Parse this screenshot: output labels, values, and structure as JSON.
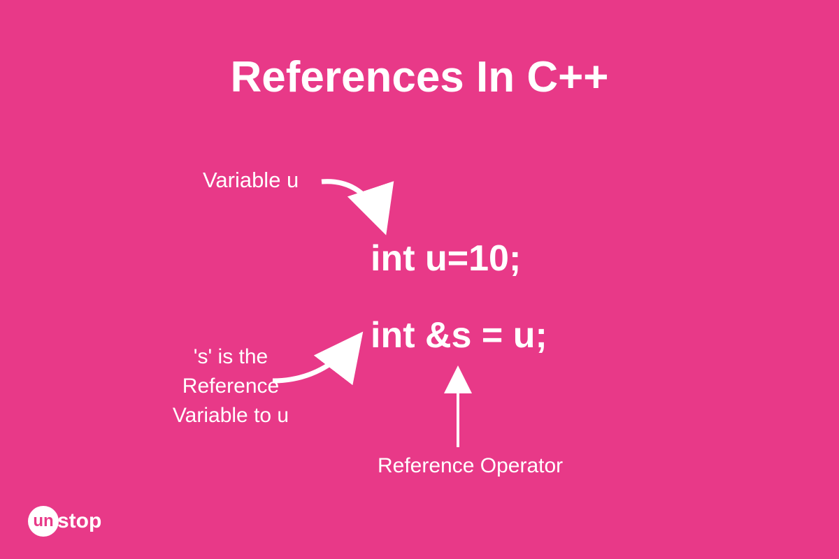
{
  "title": "References In C++",
  "labels": {
    "variable": "Variable u",
    "reference": "'s' is the Reference Variable to u",
    "operator": "Reference Operator"
  },
  "code": {
    "line1": "int u=10;",
    "line2": "int &s = u;"
  },
  "logo": {
    "circle": "un",
    "text": "stop"
  },
  "colors": {
    "background": "#e83988",
    "foreground": "#ffffff"
  }
}
